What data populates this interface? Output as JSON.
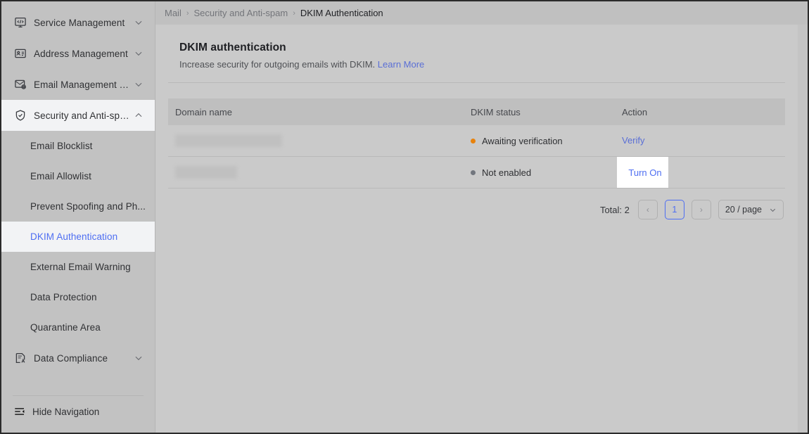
{
  "sidebar": {
    "groups": [
      {
        "label": "Service Management",
        "icon": "monitor-code-icon",
        "expanded": false,
        "chevron": "chevron-down-icon"
      },
      {
        "label": "Address Management",
        "icon": "id-card-icon",
        "expanded": false,
        "chevron": "chevron-down-icon"
      },
      {
        "label": "Email Management To...",
        "icon": "email-gear-icon",
        "expanded": false,
        "chevron": "chevron-down-icon"
      },
      {
        "label": "Security and Anti-spam",
        "icon": "shield-check-icon",
        "expanded": true,
        "chevron": "chevron-up-icon"
      }
    ],
    "items": [
      {
        "label": "Email Blocklist",
        "selected": false
      },
      {
        "label": "Email Allowlist",
        "selected": false
      },
      {
        "label": "Prevent Spoofing and Ph...",
        "selected": false
      },
      {
        "label": "DKIM Authentication",
        "selected": true
      },
      {
        "label": "External Email Warning",
        "selected": false
      },
      {
        "label": "Data Protection",
        "selected": false
      },
      {
        "label": "Quarantine Area",
        "selected": false
      }
    ],
    "group_after": {
      "label": "Data Compliance",
      "icon": "document-a-icon",
      "chevron": "chevron-down-icon"
    },
    "hide_navigation": {
      "label": "Hide Navigation",
      "icon": "collapse-panel-icon"
    }
  },
  "breadcrumb": {
    "items": [
      "Mail",
      "Security and Anti-spam",
      "DKIM Authentication"
    ],
    "separator": "›"
  },
  "page": {
    "title": "DKIM authentication",
    "subtitle": "Increase security for outgoing emails with DKIM.",
    "learn_more": "Learn More"
  },
  "table": {
    "columns": [
      "Domain name",
      "DKIM status",
      "Action"
    ],
    "rows": [
      {
        "domain": "",
        "domain_redacted": true,
        "domain_width": 152,
        "status": "Awaiting verification",
        "status_color": "#e8820c",
        "action": "Verify",
        "action_highlighted": false
      },
      {
        "domain": "",
        "domain_redacted": true,
        "domain_width": 88,
        "status": "Not enabled",
        "status_color": "#72767e",
        "action": "Turn On",
        "action_highlighted": true
      }
    ]
  },
  "pagination": {
    "total_label": "Total: 2",
    "prev": "‹",
    "next": "›",
    "current_page": "1",
    "page_size": "20 / page"
  },
  "colors": {
    "accent_blue": "#4e6ef2",
    "link_blue": "#5a6fd6",
    "status_warning": "#e8820c",
    "status_neutral": "#72767e",
    "sidebar_bg": "#c2c2c2",
    "card_bg": "#cacaca"
  }
}
